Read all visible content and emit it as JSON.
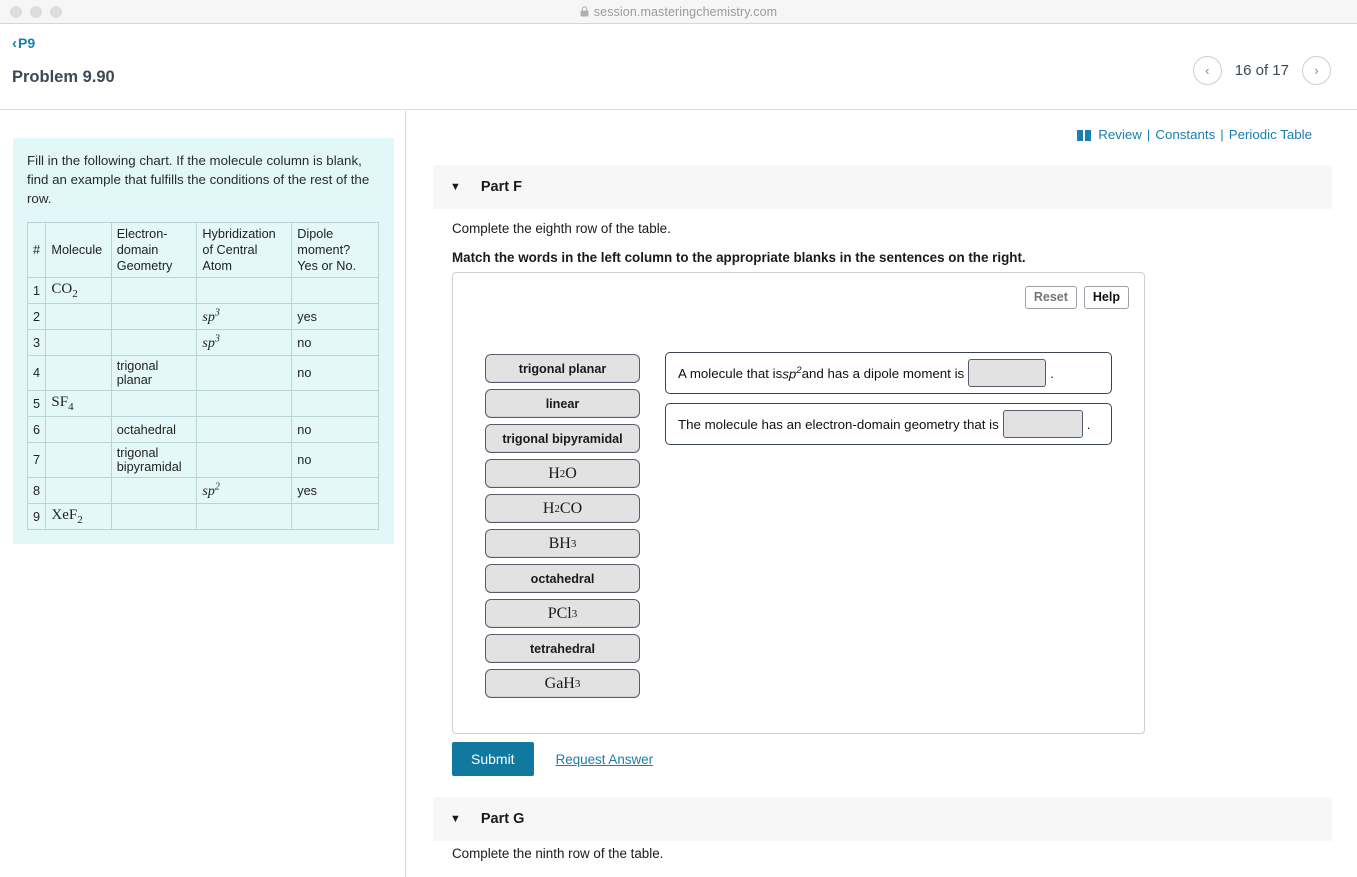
{
  "browser": {
    "url": "session.masteringchemistry.com",
    "lock_icon": "lock-icon"
  },
  "header": {
    "back_label": "P9",
    "back_chevron": "‹",
    "problem_title": "Problem 9.90",
    "pager": {
      "prev_icon": "‹",
      "next_icon": "›",
      "label": "16 of 17"
    }
  },
  "left_panel": {
    "instructions": "Fill in the following chart. If the molecule column is blank, find an example that fulfills the conditions of the rest of the row.",
    "table": {
      "headers": [
        "#",
        "Molecule",
        "Electron-domain Geometry",
        "Hybridization of Central Atom",
        "Dipole moment? Yes or No."
      ],
      "rows": [
        {
          "num": "1",
          "molecule": "CO2",
          "molecule_base": "CO",
          "molecule_sub": "2",
          "geometry": "",
          "hybridization": "",
          "hyb_base": "",
          "hyb_sup": "",
          "dipole": ""
        },
        {
          "num": "2",
          "molecule": "",
          "molecule_base": "",
          "molecule_sub": "",
          "geometry": "",
          "hybridization": "sp3",
          "hyb_base": "sp",
          "hyb_sup": "3",
          "dipole": "yes"
        },
        {
          "num": "3",
          "molecule": "",
          "molecule_base": "",
          "molecule_sub": "",
          "geometry": "",
          "hybridization": "sp3",
          "hyb_base": "sp",
          "hyb_sup": "3",
          "dipole": "no"
        },
        {
          "num": "4",
          "molecule": "",
          "molecule_base": "",
          "molecule_sub": "",
          "geometry": "trigonal planar",
          "hybridization": "",
          "hyb_base": "",
          "hyb_sup": "",
          "dipole": "no"
        },
        {
          "num": "5",
          "molecule": "SF4",
          "molecule_base": "SF",
          "molecule_sub": "4",
          "geometry": "",
          "hybridization": "",
          "hyb_base": "",
          "hyb_sup": "",
          "dipole": ""
        },
        {
          "num": "6",
          "molecule": "",
          "molecule_base": "",
          "molecule_sub": "",
          "geometry": "octahedral",
          "hybridization": "",
          "hyb_base": "",
          "hyb_sup": "",
          "dipole": "no"
        },
        {
          "num": "7",
          "molecule": "",
          "molecule_base": "",
          "molecule_sub": "",
          "geometry": "trigonal bipyramidal",
          "hybridization": "",
          "hyb_base": "",
          "hyb_sup": "",
          "dipole": "no"
        },
        {
          "num": "8",
          "molecule": "",
          "molecule_base": "",
          "molecule_sub": "",
          "geometry": "",
          "hybridization": "sp2",
          "hyb_base": "sp",
          "hyb_sup": "2",
          "dipole": "yes"
        },
        {
          "num": "9",
          "molecule": "XeF2",
          "molecule_base": "XeF",
          "molecule_sub": "2",
          "geometry": "",
          "hybridization": "",
          "hyb_base": "",
          "hyb_sup": "",
          "dipole": ""
        }
      ]
    }
  },
  "resources": {
    "icon": "book-icon",
    "review": "Review",
    "constants": "Constants",
    "periodic_table": "Periodic Table",
    "separator": "|",
    "color": "#1a7eb0"
  },
  "parts": {
    "f": {
      "caret": "▼",
      "title": "Part F",
      "instruction1": "Complete the eighth row of the table.",
      "instruction2": "Match the words in the left column to the appropriate blanks in the sentences on the right."
    },
    "g": {
      "caret": "▼",
      "title": "Part G",
      "instruction1": "Complete the ninth row of the table."
    }
  },
  "widget": {
    "reset_label": "Reset",
    "help_label": "Help",
    "word_bank": [
      {
        "label": "trigonal planar",
        "style": "word",
        "base": "trigonal planar",
        "sub": ""
      },
      {
        "label": "linear",
        "style": "word",
        "base": "linear",
        "sub": ""
      },
      {
        "label": "trigonal bipyramidal",
        "style": "word",
        "base": "trigonal bipyramidal",
        "sub": ""
      },
      {
        "label": "H2O",
        "style": "chem",
        "base": "H",
        "sub": "2",
        "tail": "O"
      },
      {
        "label": "H2CO",
        "style": "chem",
        "base": "H",
        "sub": "2",
        "tail": "CO"
      },
      {
        "label": "BH3",
        "style": "chem",
        "base": "BH",
        "sub": "3",
        "tail": ""
      },
      {
        "label": "octahedral",
        "style": "word",
        "base": "octahedral",
        "sub": ""
      },
      {
        "label": "PCl3",
        "style": "chem",
        "base": "PCl",
        "sub": "3",
        "tail": ""
      },
      {
        "label": "tetrahedral",
        "style": "word",
        "base": "tetrahedral",
        "sub": ""
      },
      {
        "label": "GaH3",
        "style": "chem",
        "base": "GaH",
        "sub": "3",
        "tail": ""
      }
    ],
    "sentences": [
      {
        "prefix": "A molecule that is ",
        "italic_base": "sp",
        "italic_sup": "2",
        "middle": " and has a dipole moment is",
        "blank_value": "",
        "suffix": "."
      },
      {
        "prefix": "The molecule has an electron-domain geometry that is",
        "italic_base": "",
        "italic_sup": "",
        "middle": "",
        "blank_value": "",
        "suffix": "."
      }
    ]
  },
  "actions": {
    "submit_label": "Submit",
    "request_answer_label": "Request Answer",
    "submit_color": "#1178a0"
  }
}
